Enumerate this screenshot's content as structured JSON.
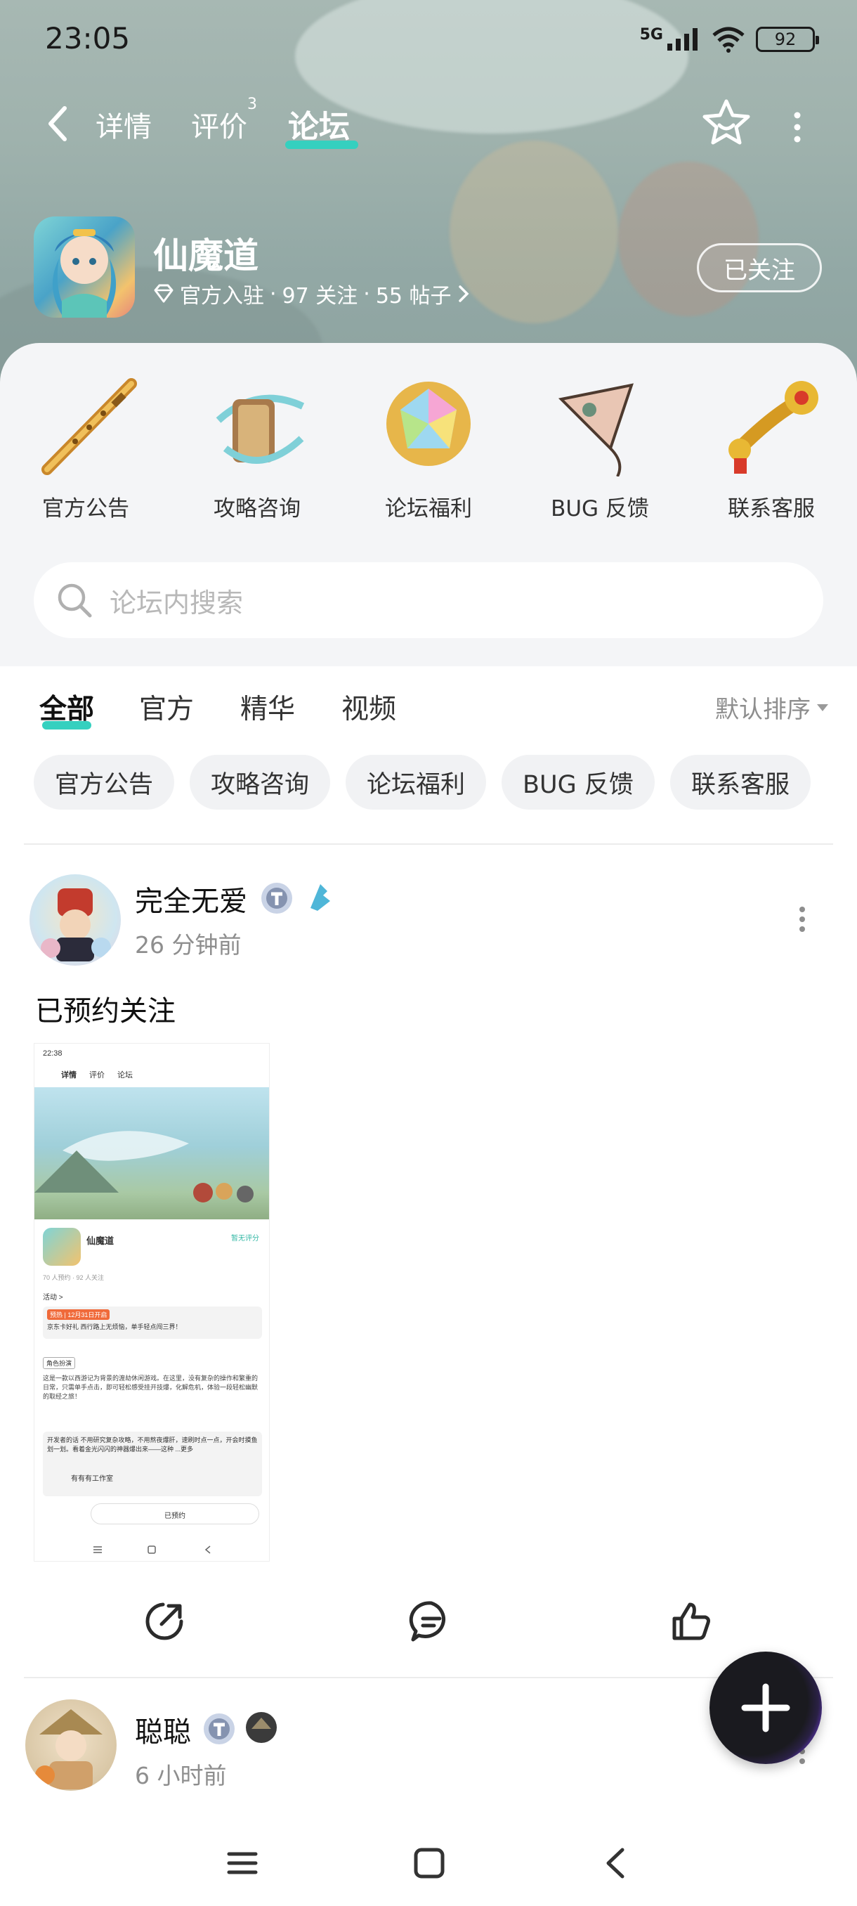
{
  "status_bar": {
    "time": "23:05",
    "network": "5G",
    "battery": "92"
  },
  "nav": {
    "back": "back",
    "tabs": [
      "详情",
      "评价",
      "论坛"
    ],
    "review_count_sup": "3",
    "active_tab": "论坛"
  },
  "game": {
    "title": "仙魔道",
    "official": "官方入驻",
    "follows": "97 关注",
    "posts": "55 帖子",
    "follow_button": "已关注"
  },
  "categories": [
    {
      "label": "官方公告",
      "icon": "flute-icon"
    },
    {
      "label": "攻略咨询",
      "icon": "scroll-icon"
    },
    {
      "label": "论坛福利",
      "icon": "gem-icon"
    },
    {
      "label": "BUG 反馈",
      "icon": "kite-icon"
    },
    {
      "label": "联系客服",
      "icon": "ruyi-icon"
    }
  ],
  "search": {
    "placeholder": "论坛内搜索"
  },
  "filter_tabs": [
    "全部",
    "官方",
    "精华",
    "视频"
  ],
  "sort": {
    "label": "默认排序"
  },
  "chips": [
    "官方公告",
    "攻略咨询",
    "论坛福利",
    "BUG 反馈",
    "联系客服"
  ],
  "posts": [
    {
      "author": "完全无爱",
      "time": "26 分钟前",
      "body": "已预约关注",
      "screenshot": {
        "time": "22:38",
        "tabs": [
          "详情",
          "评价",
          "论坛"
        ],
        "game": "仙魔道",
        "badge": "暂无评分",
        "stats": "70 人预约 · 92 人关注",
        "activity": "活动 >",
        "promo_tag": "预热 | 12月31日开启",
        "promo_text": "京东卡好礼 西行路上无烦恼，单手轻点闯三界！",
        "genre_tag": "角色扮演",
        "desc": "这是一款以西游记为背景的渡劫休闲游戏。在这里，没有复杂的操作和繁重的日常，只需单手点击，即可轻松感受挂开技爆，化解危机，体验一段轻松幽默的取经之旅！",
        "dev_note": "开发者的话 不用研究复杂攻略，不用熬夜爆肝，速刷时点一点，开会时摸鱼划一划。看着金光闪闪的神器爆出来——这种 ...更多",
        "studio": "有有有工作室",
        "reserve": "已预约"
      }
    },
    {
      "author": "聪聪",
      "time": "6 小时前"
    }
  ],
  "colors": {
    "accent": "#35d0bf",
    "header_bg": "#a0b3ae",
    "card_bg": "#f4f5f7"
  }
}
